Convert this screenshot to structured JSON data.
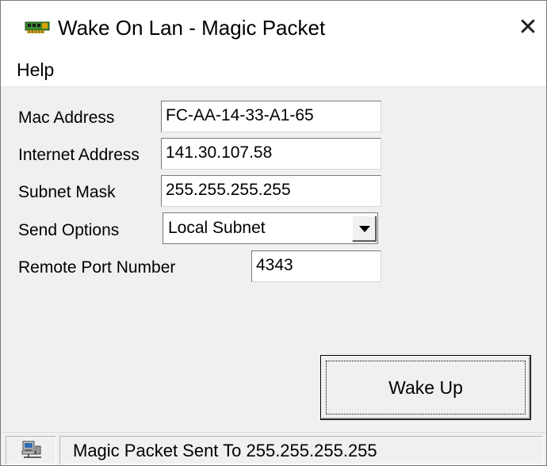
{
  "window": {
    "title": "Wake On Lan - Magic Packet",
    "close_glyph": "✕",
    "app_icon": "network-card-icon"
  },
  "menu": {
    "items": [
      {
        "label": "Help"
      }
    ]
  },
  "form": {
    "mac_label": "Mac Address",
    "mac_value": "FC-AA-14-33-A1-65",
    "internet_label": "Internet Address",
    "internet_value": "141.30.107.58",
    "subnet_label": "Subnet Mask",
    "subnet_value": "255.255.255.255",
    "send_label": "Send Options",
    "send_selected": "Local Subnet",
    "port_label": "Remote Port Number",
    "port_value": "4343"
  },
  "actions": {
    "wake_label": "Wake Up"
  },
  "status": {
    "icon": "network-computer-icon",
    "text": "Magic Packet Sent To 255.255.255.255"
  }
}
